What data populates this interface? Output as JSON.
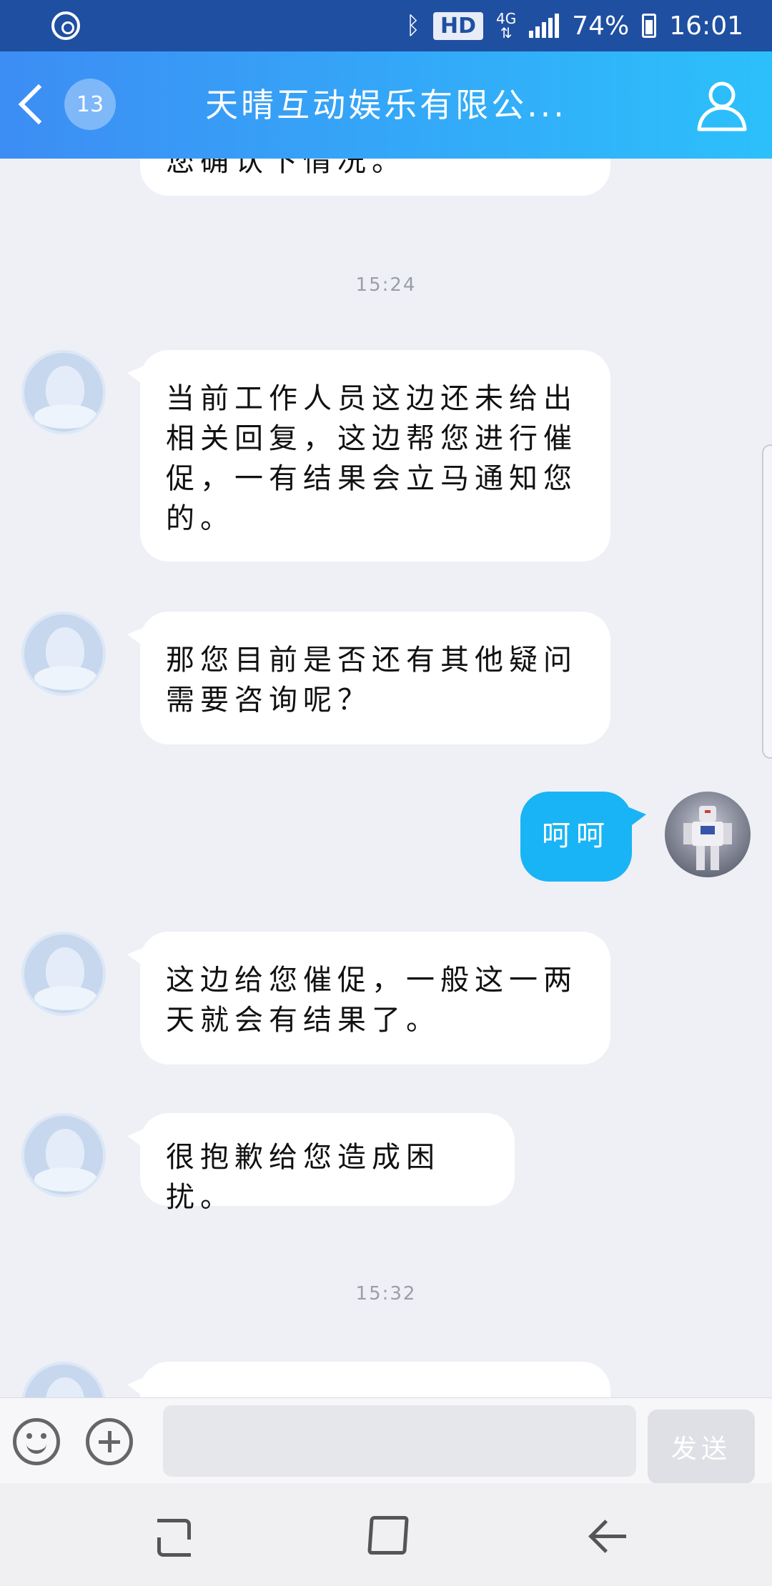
{
  "status_bar": {
    "network_badge": "HD",
    "network_type": "4G",
    "battery": "74%",
    "time": "16:01"
  },
  "header": {
    "unread_count": "13",
    "title": "天晴互动娱乐有限公..."
  },
  "messages": [
    {
      "sender": "agent",
      "text": "您确认下情况。"
    },
    {
      "type": "timestamp",
      "text": "15:24"
    },
    {
      "sender": "agent",
      "text": "当前工作人员这边还未给出相关回复，这边帮您进行催促，一有结果会立马通知您的。"
    },
    {
      "sender": "agent",
      "text": "那您目前是否还有其他疑问需要咨询呢？"
    },
    {
      "sender": "me",
      "text": "呵呵"
    },
    {
      "sender": "agent",
      "text": "这边给您催促，一般这一两天就会有结果了。"
    },
    {
      "sender": "agent",
      "text": "很抱歉给您造成困扰。"
    },
    {
      "type": "timestamp",
      "text": "15:32"
    },
    {
      "sender": "agent",
      "text": ""
    }
  ],
  "input_bar": {
    "input_value": "",
    "send_label": "发送"
  },
  "colors": {
    "header_start": "#3d8df4",
    "header_end": "#2cc0fb",
    "status_bar": "#1f4fa1",
    "my_bubble": "#19b4f5",
    "chat_background": "#eef0f6"
  },
  "icons": {
    "status_left": "sync-icon",
    "bluetooth": "bluetooth-icon",
    "signal": "signal-icon",
    "battery": "battery-icon",
    "back": "chevron-left-icon",
    "profile": "person-icon",
    "emoji": "smiley-icon",
    "plus": "plus-icon",
    "nav_recent": "recent-apps-icon",
    "nav_home": "home-icon",
    "nav_back": "back-arrow-icon"
  }
}
